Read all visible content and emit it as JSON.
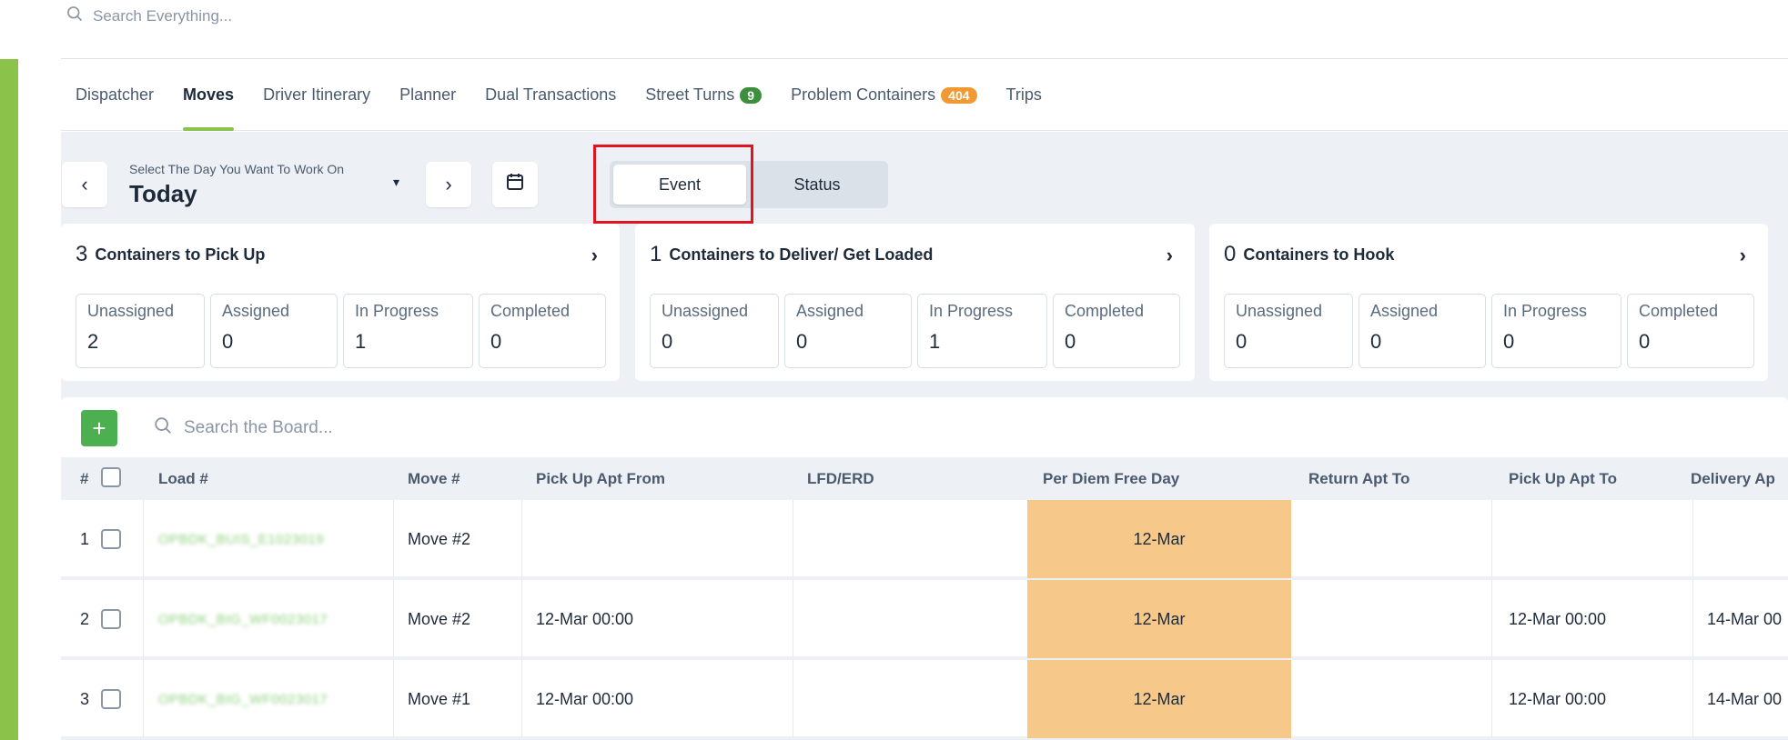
{
  "top_search": {
    "placeholder": "Search Everything..."
  },
  "tabs": [
    {
      "label": "Dispatcher"
    },
    {
      "label": "Moves",
      "active": true
    },
    {
      "label": "Driver Itinerary"
    },
    {
      "label": "Planner"
    },
    {
      "label": "Dual Transactions"
    },
    {
      "label": "Street Turns",
      "badge": "9"
    },
    {
      "label": "Problem Containers",
      "badge": "404"
    },
    {
      "label": "Trips"
    }
  ],
  "day_selector": {
    "label": "Select The Day You Want To Work On",
    "value": "Today"
  },
  "view_toggle": {
    "event": "Event",
    "status": "Status",
    "selected": "Event"
  },
  "cards": [
    {
      "count": "3",
      "title": "Containers to Pick Up",
      "stats": [
        {
          "label": "Unassigned",
          "value": "2"
        },
        {
          "label": "Assigned",
          "value": "0"
        },
        {
          "label": "In Progress",
          "value": "1"
        },
        {
          "label": "Completed",
          "value": "0"
        }
      ]
    },
    {
      "count": "1",
      "title": "Containers to Deliver/ Get Loaded",
      "stats": [
        {
          "label": "Unassigned",
          "value": "0"
        },
        {
          "label": "Assigned",
          "value": "0"
        },
        {
          "label": "In Progress",
          "value": "1"
        },
        {
          "label": "Completed",
          "value": "0"
        }
      ]
    },
    {
      "count": "0",
      "title": "Containers to Hook",
      "stats": [
        {
          "label": "Unassigned",
          "value": "0"
        },
        {
          "label": "Assigned",
          "value": "0"
        },
        {
          "label": "In Progress",
          "value": "0"
        },
        {
          "label": "Completed",
          "value": "0"
        }
      ]
    }
  ],
  "board": {
    "search_placeholder": "Search the Board...",
    "add_label": "+"
  },
  "table": {
    "headers": {
      "num": "#",
      "load": "Load #",
      "move": "Move #",
      "pickup_from": "Pick Up Apt From",
      "lfd": "LFD/ERD",
      "per_diem": "Per Diem Free Day",
      "return_to": "Return Apt To",
      "pickup_to": "Pick Up Apt To",
      "delivery": "Delivery Ap"
    },
    "rows": [
      {
        "num": "1",
        "load": "OPBDK_BUIS_E1023019",
        "move": "Move #2",
        "pickup_from": "",
        "lfd": "",
        "per_diem": "12-Mar",
        "return_to": "",
        "pickup_to": "",
        "delivery": ""
      },
      {
        "num": "2",
        "load": "OPBDK_BIG_WF0023017",
        "move": "Move #2",
        "pickup_from": "12-Mar 00:00",
        "lfd": "",
        "per_diem": "12-Mar",
        "return_to": "",
        "pickup_to": "12-Mar 00:00",
        "delivery": "14-Mar 00"
      },
      {
        "num": "3",
        "load": "OPBDK_BIG_WF0023017",
        "move": "Move #1",
        "pickup_from": "12-Mar 00:00",
        "lfd": "",
        "per_diem": "12-Mar",
        "return_to": "",
        "pickup_to": "12-Mar 00:00",
        "delivery": "14-Mar 00"
      }
    ]
  },
  "colors": {
    "accent": "#8bc34a",
    "per_diem_bg": "#f6c98a",
    "highlight": "#e0141e"
  }
}
